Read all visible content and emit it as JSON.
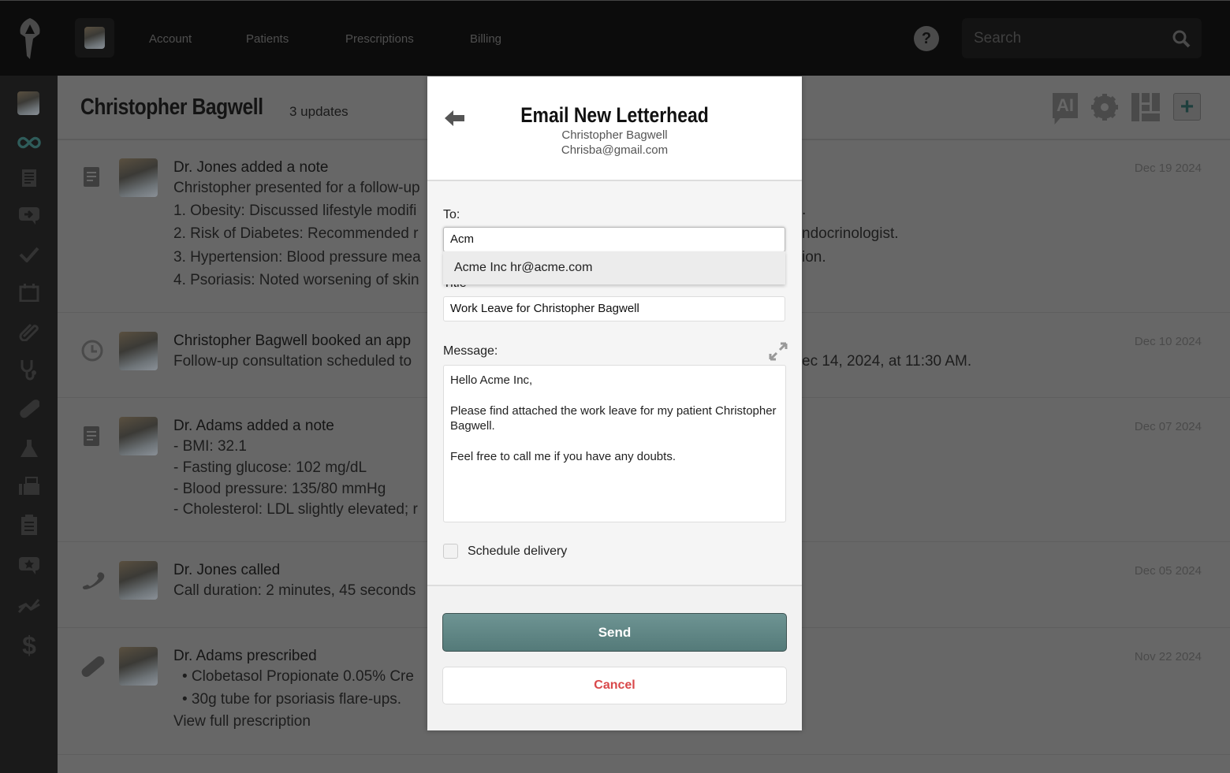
{
  "nav": {
    "items": [
      "Account",
      "Patients",
      "Prescriptions",
      "Billing"
    ],
    "search_placeholder": "Search",
    "help": "?"
  },
  "sidebar": {
    "icons": [
      "patient-avatar",
      "infinity-icon",
      "document-icon",
      "message-forward-icon",
      "check-icon",
      "calendar-icon",
      "paperclip-icon",
      "stethoscope-icon",
      "pill-icon",
      "flask-icon",
      "fax-icon",
      "clipboard-icon",
      "star-message-icon",
      "chart-line-icon",
      "dollar-icon"
    ],
    "accent": "#2f5c5a"
  },
  "header": {
    "title": "Christopher Bagwell",
    "updates": "3 updates",
    "ai_label": "AI"
  },
  "feed": [
    {
      "title": "Dr. Jones added a note",
      "date": "Dec 19 2024",
      "lines": [
        "Christopher presented for a follow-up",
        "1. Obesity: Discussed lifestyle modifi",
        "2. Risk of Diabetes: Recommended r",
        "3. Hypertension: Blood pressure mea",
        "4. Psoriasis: Noted worsening of skin"
      ],
      "right_fragments": [
        ".",
        "ndocrinologist.",
        "ion."
      ]
    },
    {
      "title": "Christopher Bagwell booked an app",
      "date": "Dec 10 2024",
      "lines": [
        "Follow-up consultation scheduled to"
      ],
      "right_fragments": [
        "ec 14, 2024, at 11:30 AM."
      ]
    },
    {
      "title": "Dr. Adams added a note",
      "date": "Dec 07 2024",
      "lines": [
        "- BMI: 32.1",
        "- Fasting glucose: 102 mg/dL",
        "- Blood pressure: 135/80 mmHg",
        "- Cholesterol: LDL slightly elevated; r"
      ]
    },
    {
      "title": "Dr. Jones called",
      "date": "Dec 05 2024",
      "lines": [
        "Call duration: 2 minutes, 45 seconds"
      ]
    },
    {
      "title": "Dr. Adams prescribed",
      "date": "Nov 22 2024",
      "lines": [
        "•  Clobetasol Propionate 0.05% Cre",
        "•   30g tube for psoriasis flare-ups."
      ],
      "link": "View full prescription"
    }
  ],
  "modal": {
    "title": "Email New Letterhead",
    "patient": "Christopher Bagwell",
    "email": "Chrisba@gmail.com",
    "to_label": "To:",
    "to_value": "Acm",
    "suggestion": "Acme Inc hr@acme.com",
    "title_label": "Title",
    "title_value": "Work Leave for Christopher Bagwell",
    "message_label": "Message:",
    "message": [
      "Hello Acme Inc,",
      "Please find attached the work leave for my patient Christopher Bagwell.",
      "Feel free to call me if you have any doubts."
    ],
    "schedule_label": "Schedule delivery",
    "schedule_checked": false,
    "send": "Send",
    "cancel": "Cancel",
    "send_color": "#5f8786",
    "cancel_color": "#d9484a"
  }
}
